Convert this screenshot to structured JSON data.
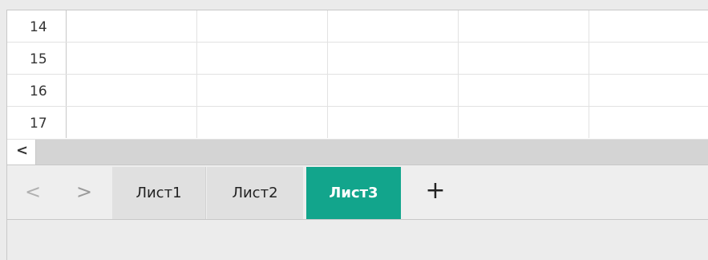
{
  "grid": {
    "rows": [
      {
        "number": "14"
      },
      {
        "number": "15"
      },
      {
        "number": "16"
      },
      {
        "number": "17"
      }
    ]
  },
  "scrollbar": {
    "left_arrow": "<"
  },
  "tabbar": {
    "prev_icon": "<",
    "next_icon": ">",
    "tabs": [
      {
        "label": "Лист1",
        "active": false
      },
      {
        "label": "Лист2",
        "active": false
      },
      {
        "label": "Лист3",
        "active": true
      }
    ],
    "add_icon": "+",
    "active_tab_color": "#12a58c"
  }
}
